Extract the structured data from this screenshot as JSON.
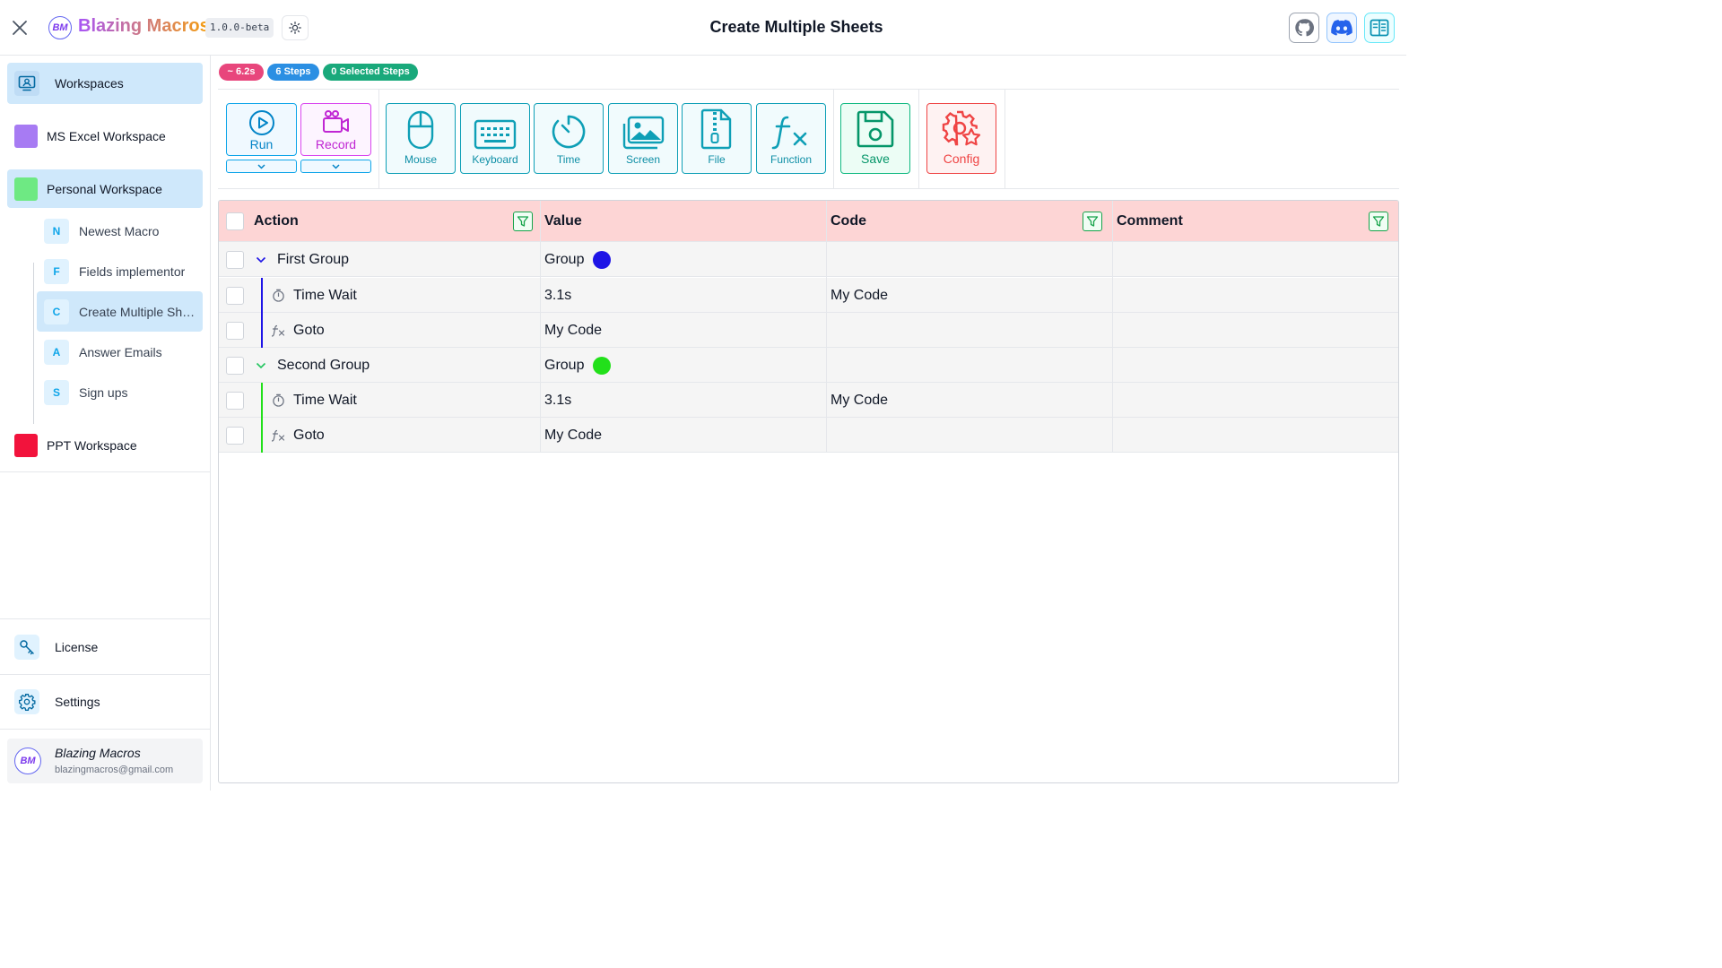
{
  "header": {
    "app_name": "Blazing Macros",
    "logo_text": "BM",
    "version": "1.0.0-beta",
    "title": "Create Multiple Sheets",
    "icons": [
      "github-icon",
      "discord-icon",
      "docs-icon"
    ]
  },
  "sidebar": {
    "workspaces_label": "Workspaces",
    "workspaces": [
      {
        "label": "MS Excel Workspace",
        "color": "#a77bf3"
      },
      {
        "label": "Personal Workspace",
        "color": "#6ee983"
      },
      {
        "label": "PPT Workspace",
        "color": "#f2133c"
      }
    ],
    "macros": [
      {
        "letter": "N",
        "label": "Newest Macro"
      },
      {
        "letter": "F",
        "label": "Fields implementor"
      },
      {
        "letter": "C",
        "label": "Create Multiple Sheets"
      },
      {
        "letter": "A",
        "label": "Answer Emails"
      },
      {
        "letter": "S",
        "label": "Sign ups"
      }
    ],
    "license_label": "License",
    "settings_label": "Settings",
    "user": {
      "name": "Blazing Macros",
      "email": "blazingmacros@gmail.com",
      "avatar_text": "BM"
    }
  },
  "badges": {
    "duration": "~ 6.2s",
    "steps": "6 Steps",
    "selected": "0 Selected Steps"
  },
  "toolbar": {
    "run_label": "Run",
    "record_label": "Record",
    "mouse_label": "Mouse",
    "keyboard_label": "Keyboard",
    "time_label": "Time",
    "screen_label": "Screen",
    "file_label": "File",
    "function_label": "Function",
    "save_label": "Save",
    "config_label": "Config"
  },
  "table": {
    "columns": {
      "action": "Action",
      "value": "Value",
      "code": "Code",
      "comment": "Comment"
    },
    "rows": [
      {
        "action": "First Group",
        "value": "Group",
        "code": "",
        "comment": ""
      },
      {
        "action": "Time Wait",
        "value": "3.1s",
        "code": "My Code",
        "comment": ""
      },
      {
        "action": "Goto",
        "value": "My Code",
        "code": "",
        "comment": ""
      },
      {
        "action": "Second Group",
        "value": "Group",
        "code": "",
        "comment": ""
      },
      {
        "action": "Time Wait",
        "value": "3.1s",
        "code": "My Code",
        "comment": ""
      },
      {
        "action": "Goto",
        "value": "My Code",
        "code": "",
        "comment": ""
      }
    ],
    "group_colors": {
      "first": "#1e14e6",
      "second": "#22e01a"
    }
  },
  "colors": {
    "accent": "#0ea5e9",
    "header_row": "#fdd5d5",
    "badge_duration": "#e8467c",
    "badge_steps": "#2b8fe3",
    "badge_selected": "#19a97b"
  }
}
